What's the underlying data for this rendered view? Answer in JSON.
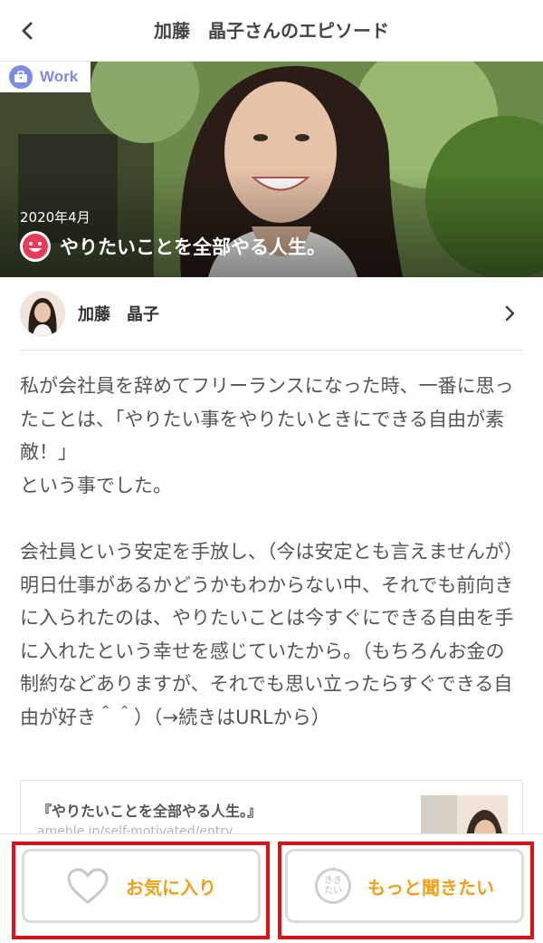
{
  "header": {
    "title": "加藤　晶子さんのエピソード"
  },
  "hero": {
    "category": "Work",
    "date": "2020年4月",
    "title": "やりたいことを全部やる人生。",
    "mood_icon": "smile-face-icon"
  },
  "author": {
    "name": "加藤　晶子"
  },
  "body": "私が会社員を辞めてフリーランスになった時、一番に思ったことは、「やりたい事をやりたいときにできる自由が素敵！」\nという事でした。\n\n会社員という安定を手放し、（今は安定とも言えませんが）明日仕事があるかどうかもわからない中、それでも前向きに入られたのは、やりたいことは今すぐにできる自由を手に入れたという幸せを感じていたから。（もちろんお金の制約などありますが、それでも思い立ったらすぐできる自由が好き＾＾）（→続きはURLから）",
  "link_card": {
    "title": "『やりたいことを全部やる人生。』",
    "url": "amehle.jp/self-motivated/entry"
  },
  "buttons": {
    "favorite": "お気に入り",
    "more": "もっと聞きたい",
    "more_icon_text": "きき\nたい"
  },
  "colors": {
    "accent": "#f0a016",
    "category": "#7f8ae0",
    "highlight": "#e0101a"
  }
}
